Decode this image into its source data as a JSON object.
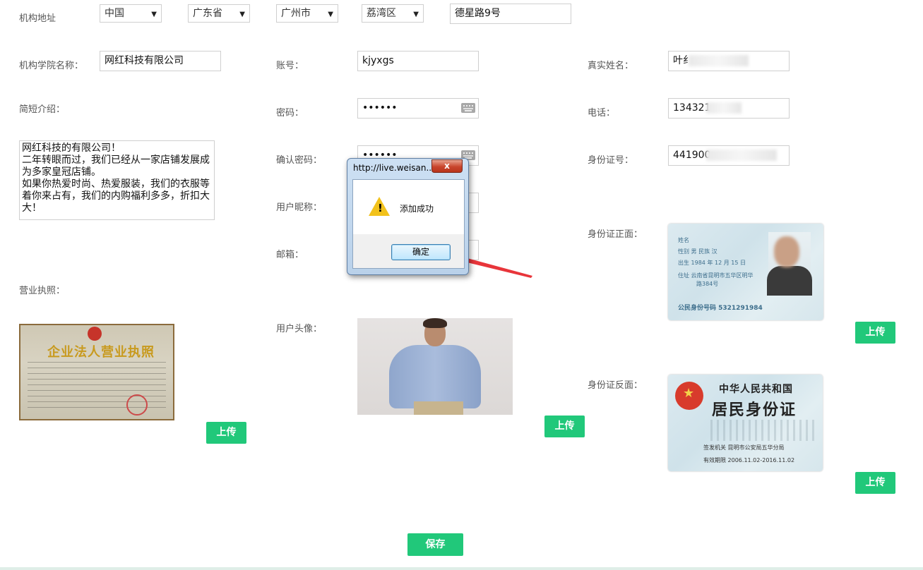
{
  "address": {
    "label": "机构地址",
    "country": "中国",
    "province": "广东省",
    "city": "广州市",
    "district": "荔湾区",
    "street": "德星路9号"
  },
  "form": {
    "institution_label": "机构学院名称：",
    "institution_value": "网红科技有限公司",
    "account_label": "账号：",
    "account_value": "kjyxgs",
    "realname_label": "真实姓名：",
    "realname_value": "叶纟",
    "intro_label": "简短介绍：",
    "intro_value": "网红科技的有限公司！\n二年转眼而过，我们已经从一家店铺发展成为多家皇冠店铺。\n如果你热爱时尚、热爱服装，我们的衣服等着你来占有，我们的内购福利多多，折扣大大！",
    "password_label": "密码：",
    "password_value": "••••••",
    "phone_label": "电话：",
    "phone_value": "134321",
    "confirm_label": "确认密码：",
    "confirm_value": "••••••",
    "idnum_label": "身份证号：",
    "idnum_value": "441900",
    "nickname_label": "用户昵称：",
    "email_label": "邮箱：",
    "license_label": "营业执照：",
    "avatar_label": "用户头像：",
    "idfront_label": "身份证正面：",
    "idback_label": "身份证反面："
  },
  "images": {
    "license_title": "企业法人营业执照",
    "idfront_lines": [
      "姓名",
      "性别 男   民族 汉",
      "出生 1984 年 12 月 15 日",
      "住址 云南省昆明市五华区明华",
      "路384号",
      "公民身份号码   5321291984"
    ],
    "idback_country": "中华人民共和国",
    "idback_title": "居民身份证",
    "idback_authority": "签发机关   昆明市公安局五华分局",
    "idback_valid": "有效期限   2006.11.02-2016.11.02"
  },
  "buttons": {
    "upload": "上传",
    "save": "保存"
  },
  "dialog": {
    "title": "http://live.weisan...",
    "close": "x",
    "message": "添加成功",
    "ok": "确定"
  },
  "colors": {
    "accent": "#21c87a",
    "arrow": "#e8353a"
  }
}
